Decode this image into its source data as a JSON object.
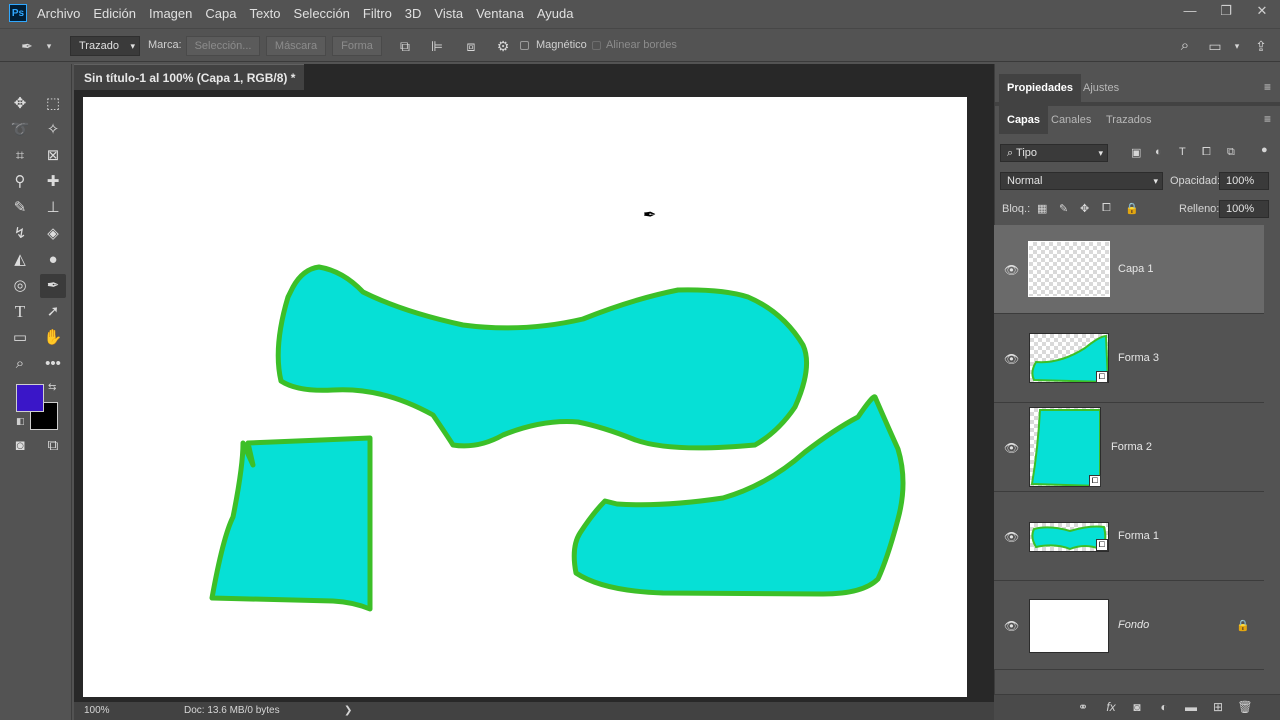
{
  "app": {
    "logo": "Ps",
    "menu": [
      "Archivo",
      "Edición",
      "Imagen",
      "Capa",
      "Texto",
      "Selección",
      "Filtro",
      "3D",
      "Vista",
      "Ventana",
      "Ayuda"
    ],
    "window_controls": [
      "minimize-icon",
      "restore-icon",
      "close-icon"
    ]
  },
  "options": {
    "mode": "Trazado",
    "marca_label": "Marca:",
    "seleccion": "Selección...",
    "mascara": "Máscara",
    "forma": "Forma",
    "magnetico": "Magnético",
    "alinear": "Alinear bordes"
  },
  "document": {
    "tab_title": "Sin título-1 al 100% (Capa 1, RGB/8) *",
    "tab_close": "×",
    "zoom": "100%",
    "doc_info": "Doc: 13.6 MB/0 bytes",
    "status_arrow": "❯"
  },
  "colors": {
    "foreground": "#3a16c8",
    "background": "#000000",
    "shape_fill": "#06e0d6",
    "shape_stroke": "#3cbf28"
  },
  "panels": {
    "top_tabs": [
      "Propiedades",
      "Ajustes"
    ],
    "layer_tabs": [
      "Capas",
      "Canales",
      "Trazados"
    ],
    "filter": "Tipo",
    "blend_mode": "Normal",
    "opacity_label": "Opacidad:",
    "opacity": "100%",
    "lock_label": "Bloq.:",
    "fill_label": "Relleno:",
    "fill": "100%"
  },
  "layers": [
    {
      "name": "Capa 1",
      "selected": true
    },
    {
      "name": "Forma 3",
      "selected": false
    },
    {
      "name": "Forma 2",
      "selected": false
    },
    {
      "name": "Forma 1",
      "selected": false
    },
    {
      "name": "Fondo",
      "selected": false,
      "locked": true
    }
  ]
}
